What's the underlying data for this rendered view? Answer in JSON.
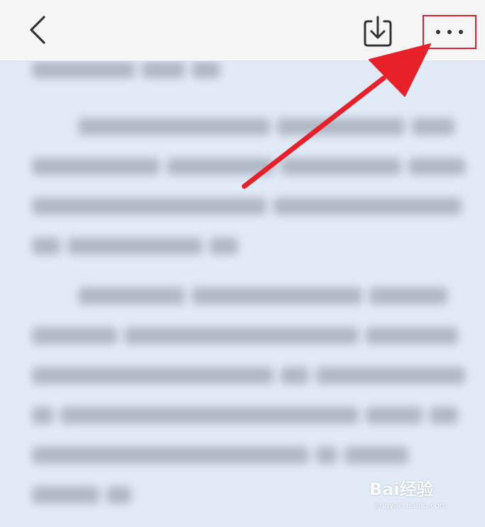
{
  "toolbar": {
    "back_icon": "chevron-left-icon",
    "download_icon": "download-icon",
    "more_icon": "more-horizontal-icon",
    "highlight_color": "#e02030"
  },
  "document": {
    "blurred": true,
    "background_color": "#e1ebf8"
  },
  "annotation": {
    "arrow_color": "#e8202a",
    "target": "more-button"
  },
  "watermark": {
    "main": "Bai经验",
    "sub": "jingyan.baidu.com"
  }
}
